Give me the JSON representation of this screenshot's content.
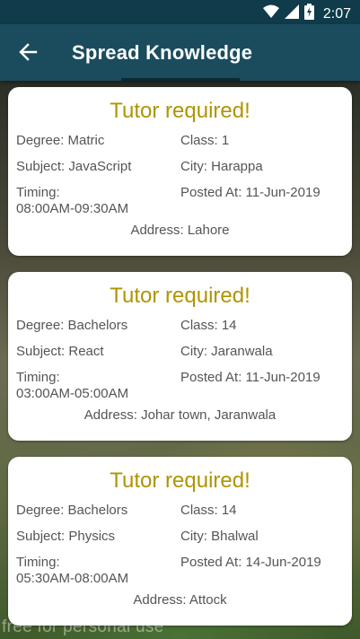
{
  "status_bar": {
    "time": "2:07",
    "icons": [
      "wifi-icon",
      "signal-icon",
      "battery-charging-icon"
    ]
  },
  "app_bar": {
    "title": "Spread Knowledge",
    "back_icon": "arrow-left-icon"
  },
  "colors": {
    "status_bar": "#0f3b4a",
    "app_bar": "#1b4c5e",
    "heading": "#b09400",
    "card_text": "#555555"
  },
  "posts": [
    {
      "heading": "Tutor required!",
      "degree": "Degree: Matric",
      "class": "Class: 1",
      "subject": "Subject: JavaScript",
      "city": "City: Harappa",
      "timing_label": "Timing:",
      "timing": "08:00AM-09:30AM",
      "posted": "Posted At: 11-Jun-2019",
      "address": "Address: Lahore"
    },
    {
      "heading": "Tutor required!",
      "degree": "Degree: Bachelors",
      "class": "Class: 14",
      "subject": "Subject: React",
      "city": "City: Jaranwala",
      "timing_label": "Timing:",
      "timing": "03:00AM-05:00AM",
      "posted": "Posted At: 11-Jun-2019",
      "address": "Address: Johar town, Jaranwala"
    },
    {
      "heading": "Tutor required!",
      "degree": "Degree: Bachelors",
      "class": "Class: 14",
      "subject": "Subject: Physics",
      "city": "City: Bhalwal",
      "timing_label": "Timing:",
      "timing": "05:30AM-08:00AM",
      "posted": "Posted At: 14-Jun-2019",
      "address": "Address: Attock"
    }
  ],
  "background": {
    "watermark": "free for personal use"
  }
}
